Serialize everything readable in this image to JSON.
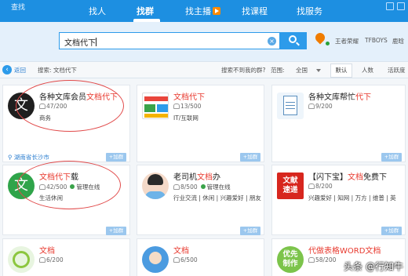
{
  "app_title": "查找",
  "nav": {
    "items": [
      {
        "label": "找人"
      },
      {
        "label": "找群"
      },
      {
        "label": "找主播"
      },
      {
        "label": "找课程"
      },
      {
        "label": "找服务"
      }
    ]
  },
  "search": {
    "value": "文档代下",
    "clear_symbol": "×"
  },
  "hot_tags": [
    "王者荣耀",
    "TFBOYS",
    "鹿晗"
  ],
  "filter_bar": {
    "back_label": "返回",
    "search_label": "搜索: 文档代下",
    "not_found": "搜索不到我的群?",
    "range_label": "范围:",
    "range_value": "全国",
    "sort_default": "默认",
    "sort_count": "人数",
    "sort_active": "活跃度"
  },
  "cards": [
    {
      "title_plain": "各种文库会员",
      "title_hl": "文档代下",
      "title_rest": "",
      "members": "47/200",
      "managed": "",
      "tags": "商务",
      "location": "湖南省长沙市",
      "join": "+加群"
    },
    {
      "title_plain": "",
      "title_hl": "文档代下",
      "title_rest": "",
      "members": "13/500",
      "managed": "",
      "tags": "IT/互联网",
      "location": "",
      "join": "+加群"
    },
    {
      "title_plain": "各种文库帮忙",
      "title_hl": "代下",
      "title_rest": "",
      "members": "9/200",
      "managed": "",
      "tags": "",
      "location": "",
      "join": "+加群"
    },
    {
      "title_plain": "",
      "title_hl": "文档代下",
      "title_rest": "载",
      "members": "42/500",
      "managed": "管理在线",
      "tags": "生活休闲",
      "location": "",
      "join": "+加群"
    },
    {
      "title_plain": "老司机",
      "title_hl": "文档",
      "title_rest": "办",
      "members": "8/500",
      "managed": "管理在线",
      "tags": "行业交流 | 休闲 | 兴趣爱好 | 朋友",
      "location": "",
      "join": "+加群"
    },
    {
      "title_plain": "【闪下宝】",
      "title_hl": "文档",
      "title_rest": "免费下",
      "members": "8/200",
      "managed": "",
      "tags": "兴趣爱好 | 知网 | 万方 | 维普 | 英",
      "location": "",
      "join": "+加群"
    },
    {
      "title_plain": "",
      "title_hl": "文档",
      "title_rest": "",
      "members": "6/200",
      "managed": "",
      "tags": "",
      "location": "",
      "join": ""
    },
    {
      "title_plain": "",
      "title_hl": "文档",
      "title_rest": "",
      "members": "6/500",
      "managed": "",
      "tags": "",
      "location": "",
      "join": ""
    },
    {
      "title_plain": "代做表格WORD",
      "title_hl": "文档",
      "title_rest": "",
      "members": "58/200",
      "managed": "",
      "tags": "",
      "location": "",
      "join": ""
    }
  ],
  "avatar_text": {
    "card1": "文",
    "card4": "文",
    "card6": "文献\n速递",
    "card9": "优先\n制作"
  },
  "watermark": "头条 @行知牛",
  "colors": {
    "nav": "#1d8fe1",
    "highlight": "#e8392e",
    "accent": "#2d9bea",
    "annotation": "#e14a4a"
  }
}
